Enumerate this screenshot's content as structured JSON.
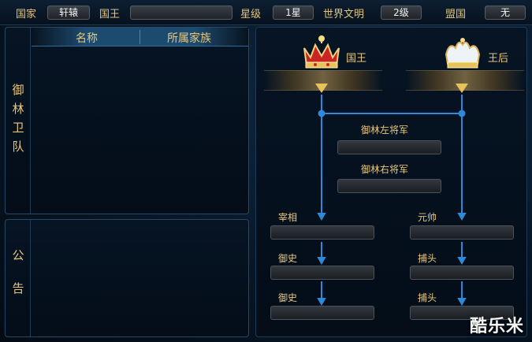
{
  "topbar": {
    "country_label": "国家",
    "country_value": "轩辕",
    "king_label": "国王",
    "king_value": "",
    "star_label": "星级",
    "star_value": "1星",
    "civ_label": "世界文明",
    "civ_value": "2级",
    "ally_label": "盟国",
    "ally_value": "无"
  },
  "guards_panel": {
    "side_chars": [
      "御",
      "林",
      "卫",
      "队"
    ],
    "columns": [
      "名称",
      "所属家族"
    ]
  },
  "notice_panel": {
    "side_chars": [
      "公",
      "告"
    ]
  },
  "hierarchy": {
    "king_label": "国王",
    "queen_label": "王后",
    "left_general": "御林左将军",
    "right_general": "御林右将军",
    "chancellor": "宰相",
    "marshal": "元帅",
    "censor": "御史",
    "constable": "捕头",
    "line_color": "#2d8ad6",
    "gold_color": "#e8c77a"
  },
  "watermark": "酷乐米"
}
